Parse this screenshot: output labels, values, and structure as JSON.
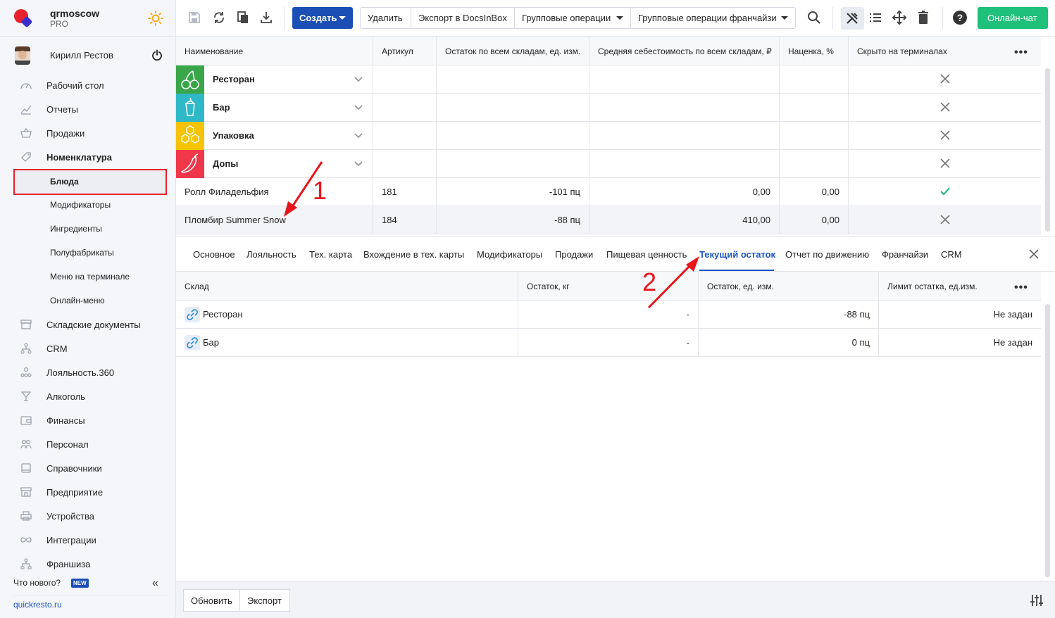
{
  "brand": {
    "name": "qrmoscow",
    "plan": "PRO"
  },
  "user": {
    "name": "Кирилл Рестов"
  },
  "sidebar": {
    "items": [
      {
        "label": "Рабочий стол",
        "icon": "dashboard-icon"
      },
      {
        "label": "Отчеты",
        "icon": "chart-icon"
      },
      {
        "label": "Продажи",
        "icon": "basket-icon"
      },
      {
        "label": "Номенклатура",
        "icon": "tag-icon"
      }
    ],
    "sub_items": [
      {
        "label": "Блюда"
      },
      {
        "label": "Модификаторы"
      },
      {
        "label": "Ингредиенты"
      },
      {
        "label": "Полуфабрикаты"
      },
      {
        "label": "Меню на терминале"
      },
      {
        "label": "Онлайн-меню"
      }
    ],
    "items2": [
      {
        "label": "Складские документы",
        "icon": "box-icon"
      },
      {
        "label": "CRM",
        "icon": "network-icon"
      },
      {
        "label": "Лояльность.360",
        "icon": "loyalty-icon"
      },
      {
        "label": "Алкоголь",
        "icon": "glass-icon"
      },
      {
        "label": "Финансы",
        "icon": "wallet-icon"
      },
      {
        "label": "Персонал",
        "icon": "people-icon"
      },
      {
        "label": "Справочники",
        "icon": "book-icon"
      },
      {
        "label": "Предприятие",
        "icon": "store-icon"
      },
      {
        "label": "Устройства",
        "icon": "printer-icon"
      },
      {
        "label": "Интеграции",
        "icon": "infinity-icon"
      },
      {
        "label": "Франшиза",
        "icon": "franchise-icon"
      }
    ],
    "whats_new": "Что нового?",
    "new_badge": "NEW",
    "site_link": "quickresto.ru"
  },
  "toolbar": {
    "create_label": "Создать",
    "delete_label": "Удалить",
    "export_label": "Экспорт в DocsInBox",
    "group_ops_label": "Групповые операции",
    "group_ops_franchise_label": "Групповые операции франчайзи",
    "chat_label": "Онлайн-чат"
  },
  "grid": {
    "headers": [
      "Наименование",
      "Артикул",
      "Остаток по всем складам, ед. изм.",
      "Средняя себестоимость по всем складам, ₽",
      "Наценка, %",
      "Скрыто на терминалах"
    ],
    "categories": [
      {
        "name": "Ресторан",
        "color": "#3aa64a",
        "icon": "cherry-icon",
        "hidden": "cross"
      },
      {
        "name": "Бар",
        "color": "#2fb8c8",
        "icon": "cup-icon",
        "hidden": "cross"
      },
      {
        "name": "Упаковка",
        "color": "#f5c300",
        "icon": "honeycomb-icon",
        "hidden": "cross"
      },
      {
        "name": "Допы",
        "color": "#f0384a",
        "icon": "pepper-icon",
        "hidden": "cross"
      }
    ],
    "rows": [
      {
        "name": "Ролл Филадельфия",
        "article": "181",
        "stock": "-101 пц",
        "cost": "0,00",
        "markup": "0,00",
        "hidden": "check"
      },
      {
        "name": "Пломбир Summer Snow",
        "article": "184",
        "stock": "-88 пц",
        "cost": "410,00",
        "markup": "0,00",
        "hidden": "cross"
      }
    ]
  },
  "detail": {
    "tabs": [
      "Основное",
      "Лояльность",
      "Тех. карта",
      "Вхождение в тех. карты",
      "Модификаторы",
      "Продажи",
      "Пищевая ценность",
      "Текущий остаток",
      "Отчет по движению",
      "Франчайзи",
      "CRM"
    ],
    "active_tab": "Текущий остаток",
    "headers": [
      "Склад",
      "Остаток, кг",
      "Остаток, ед. изм.",
      "Лимит остатка, ед.изм."
    ],
    "rows": [
      {
        "warehouse": "Ресторан",
        "kg": "-",
        "units": "-88 пц",
        "limit": "Не задан"
      },
      {
        "warehouse": "Бар",
        "kg": "-",
        "units": "0 пц",
        "limit": "Не задан"
      }
    ]
  },
  "footer": {
    "refresh_label": "Обновить",
    "export_label": "Экспорт"
  },
  "annotations": {
    "one": "1",
    "two": "2"
  }
}
